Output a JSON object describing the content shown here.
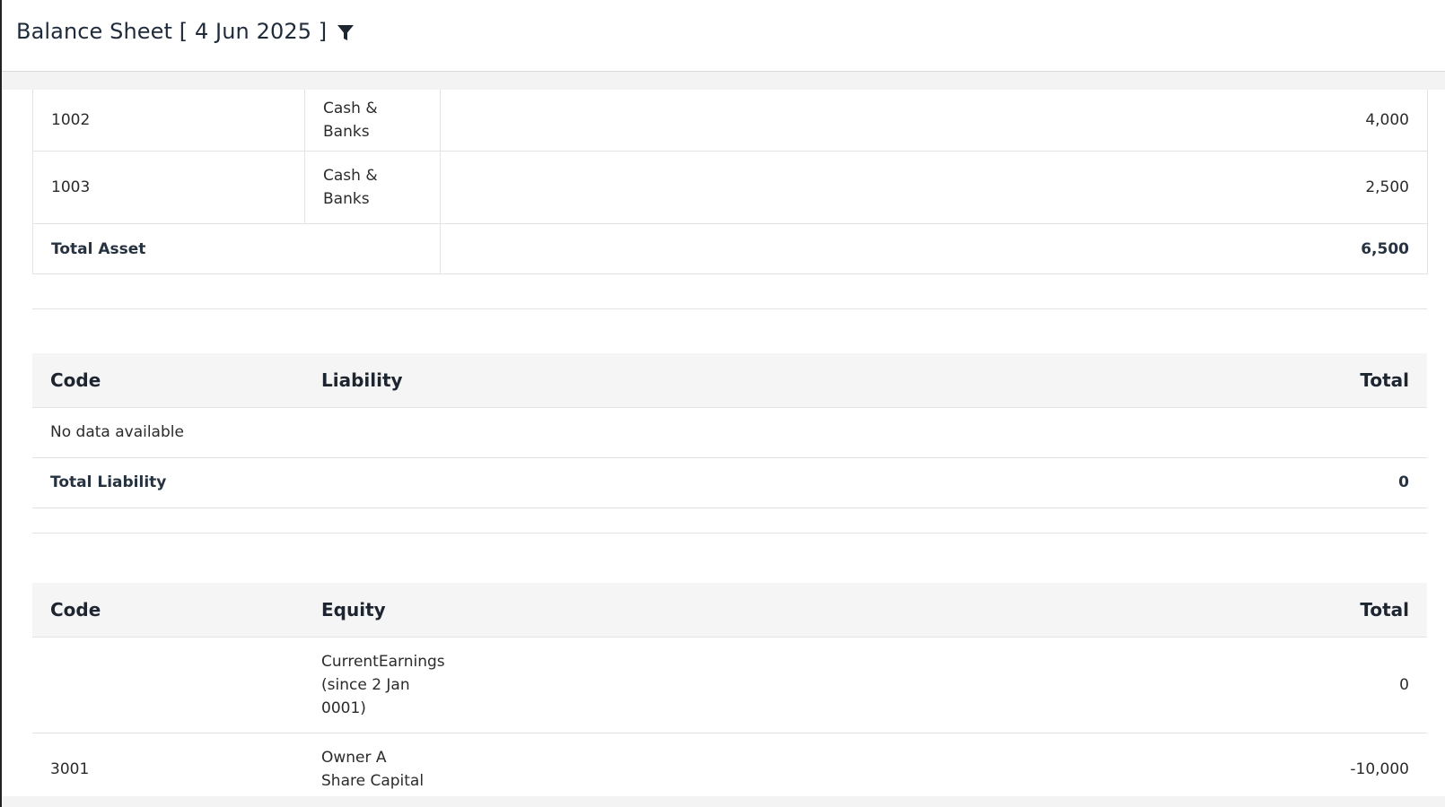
{
  "header": {
    "title": "Balance Sheet [ 4 Jun 2025 ]",
    "filter_icon": "filter-icon"
  },
  "assets": {
    "rows": [
      {
        "code": "1002",
        "group": "Cash & Banks",
        "total": "4,000"
      },
      {
        "code": "1003",
        "group": "Cash & Banks",
        "total": "2,500"
      }
    ],
    "total_label": "Total Asset",
    "total_value": "6,500"
  },
  "liability": {
    "columns": {
      "code": "Code",
      "name": "Liability",
      "total": "Total"
    },
    "empty_text": "No data available",
    "total_label": "Total Liability",
    "total_value": "0"
  },
  "equity": {
    "columns": {
      "code": "Code",
      "name": "Equity",
      "total": "Total"
    },
    "rows": [
      {
        "code": "",
        "name": "CurrentEarnings (since 2 Jan 0001)",
        "total": "0"
      },
      {
        "code": "3001",
        "name": "Owner A Share Capital",
        "total": "-10,000"
      }
    ]
  }
}
